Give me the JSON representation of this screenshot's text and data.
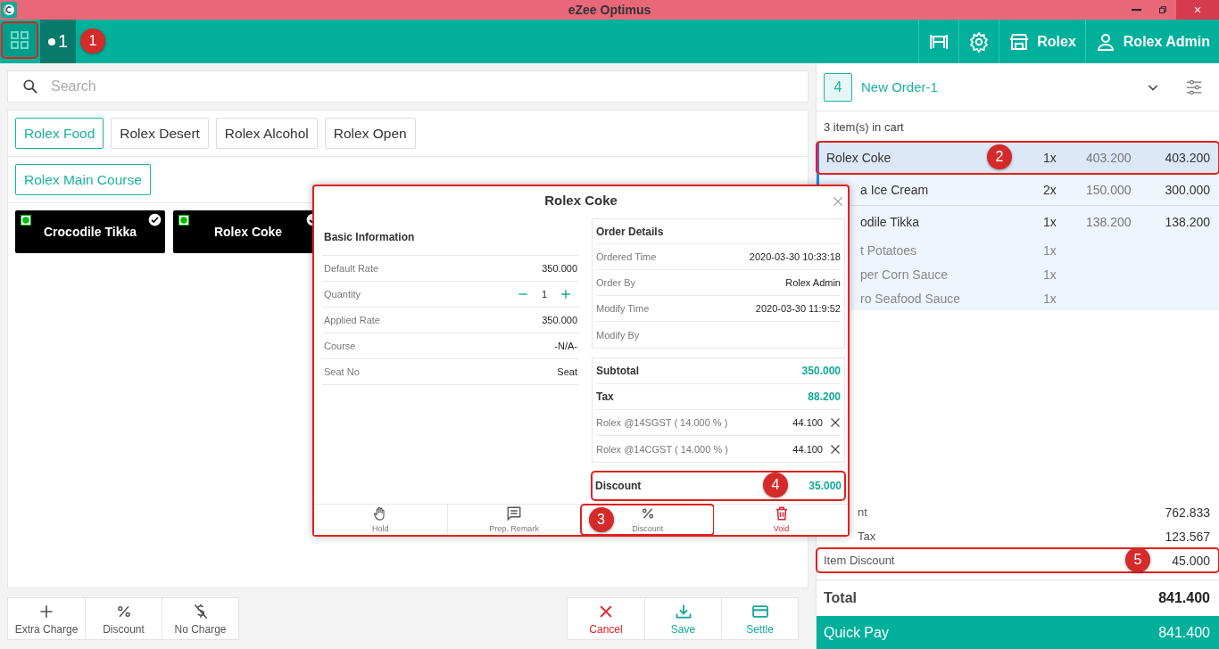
{
  "window": {
    "title": "eZee Optimus"
  },
  "topbar": {
    "grid_button": {
      "callout": "1"
    },
    "tabs": [
      {
        "label": "1",
        "selected": true
      }
    ],
    "actions": [
      {
        "kind": "tables"
      },
      {
        "kind": "settings"
      },
      {
        "kind": "outlet",
        "label": "Rolex"
      },
      {
        "kind": "user",
        "label": "Rolex Admin"
      }
    ]
  },
  "search": {
    "placeholder": "Search"
  },
  "categories": [
    {
      "label": "Rolex Food",
      "selected": true
    },
    {
      "label": "Rolex Desert",
      "selected": false
    },
    {
      "label": "Rolex Alcohol",
      "selected": false
    },
    {
      "label": "Rolex Open",
      "selected": false
    }
  ],
  "subcategories": [
    {
      "label": "Rolex Main Course",
      "selected": true
    }
  ],
  "products": [
    {
      "name": "Crocodile Tikka",
      "checked": true
    },
    {
      "name": "Rolex Coke",
      "checked": true
    }
  ],
  "bottom_left": [
    {
      "kind": "plus",
      "label": "Extra Charge"
    },
    {
      "kind": "percent",
      "label": "Discount"
    },
    {
      "kind": "nocharge",
      "label": "No Charge"
    }
  ],
  "bottom_right": [
    {
      "kind": "cancel",
      "label": "Cancel"
    },
    {
      "kind": "save",
      "label": "Save"
    },
    {
      "kind": "settle",
      "label": "Settle"
    }
  ],
  "dialog": {
    "title": "Rolex Coke",
    "basic": {
      "heading": "Basic Information",
      "rows": [
        {
          "label": "Default Rate",
          "value": "350.000"
        },
        {
          "label": "Quantity",
          "value": "1",
          "kind": "stepper"
        },
        {
          "label": "Applied Rate",
          "value": "350.000"
        },
        {
          "label": "Course",
          "value": "-N/A-"
        },
        {
          "label": "Seat No",
          "value": "Seat"
        }
      ]
    },
    "order": {
      "heading": "Order Details",
      "rows": [
        {
          "label": "Ordered Time",
          "value": "2020-03-30 10:33:18"
        },
        {
          "label": "Order By",
          "value": "Rolex Admin"
        },
        {
          "label": "Modify Time",
          "value": "2020-03-30 11:9:52"
        },
        {
          "label": "Modify By"
        }
      ]
    },
    "totals": [
      {
        "label": "Subtotal",
        "value": "350.000",
        "kind": "main"
      },
      {
        "label": "Tax",
        "value": "88.200",
        "kind": "main"
      },
      {
        "label": "Rolex @14SGST ( 14.000 % )",
        "value": "44.100",
        "kind": "tax"
      },
      {
        "label": "Rolex @14CGST ( 14.000 % )",
        "value": "44.100",
        "kind": "tax"
      }
    ],
    "discount": {
      "label": "Discount",
      "value": "35.000",
      "callout": "4"
    },
    "actions": [
      {
        "kind": "hold",
        "label": "Hold"
      },
      {
        "kind": "remark",
        "label": "Prep. Remark"
      },
      {
        "kind": "discount",
        "label": "Discount",
        "callout": "3"
      },
      {
        "kind": "void",
        "label": "Void"
      }
    ]
  },
  "cart": {
    "count": "4",
    "order_name": "New Order-1",
    "items_text": "3 item(s) in cart",
    "items": [
      {
        "name": "Rolex Coke",
        "qty": "1x",
        "rate": "403.200",
        "amount": "403.200",
        "selected": true,
        "callout": "2"
      },
      {
        "name": "a Ice Cream",
        "qty": "2x",
        "rate": "150.000",
        "amount": "300.000",
        "selected": false,
        "cut": true
      },
      {
        "name": "odile Tikka",
        "qty": "1x",
        "rate": "138.200",
        "amount": "138.200",
        "selected": false,
        "cut": true,
        "children": [
          {
            "name": "t Potatoes",
            "qty": "1x",
            "cut": true
          },
          {
            "name": "per Corn Sauce",
            "qty": "1x",
            "cut": true
          },
          {
            "name": "ro Seafood Sauce",
            "qty": "1x",
            "cut": true
          }
        ]
      }
    ]
  },
  "summary": [
    {
      "label": "nt",
      "value": "762.833",
      "cut": true
    },
    {
      "label": "Tax",
      "value": "123.567",
      "cut": true
    },
    {
      "label": "Item Discount",
      "value": "45.000",
      "callout": "5"
    }
  ],
  "total": {
    "label": "Total",
    "value": "841.400"
  },
  "quick_pay": {
    "label": "Quick Pay",
    "value": "841.400"
  }
}
